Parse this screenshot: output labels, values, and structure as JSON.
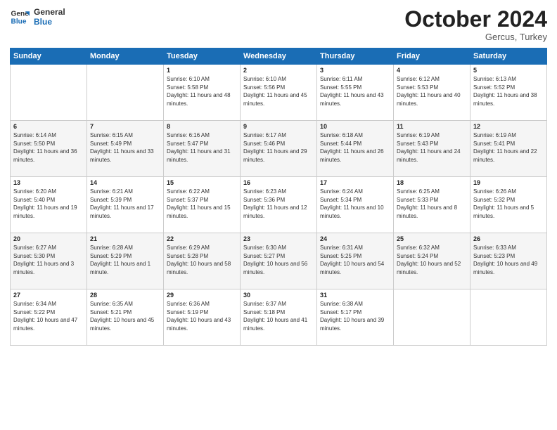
{
  "logo": {
    "line1": "General",
    "line2": "Blue"
  },
  "title": "October 2024",
  "subtitle": "Gercus, Turkey",
  "headers": [
    "Sunday",
    "Monday",
    "Tuesday",
    "Wednesday",
    "Thursday",
    "Friday",
    "Saturday"
  ],
  "weeks": [
    [
      {
        "num": "",
        "info": ""
      },
      {
        "num": "",
        "info": ""
      },
      {
        "num": "1",
        "info": "Sunrise: 6:10 AM\nSunset: 5:58 PM\nDaylight: 11 hours and 48 minutes."
      },
      {
        "num": "2",
        "info": "Sunrise: 6:10 AM\nSunset: 5:56 PM\nDaylight: 11 hours and 45 minutes."
      },
      {
        "num": "3",
        "info": "Sunrise: 6:11 AM\nSunset: 5:55 PM\nDaylight: 11 hours and 43 minutes."
      },
      {
        "num": "4",
        "info": "Sunrise: 6:12 AM\nSunset: 5:53 PM\nDaylight: 11 hours and 40 minutes."
      },
      {
        "num": "5",
        "info": "Sunrise: 6:13 AM\nSunset: 5:52 PM\nDaylight: 11 hours and 38 minutes."
      }
    ],
    [
      {
        "num": "6",
        "info": "Sunrise: 6:14 AM\nSunset: 5:50 PM\nDaylight: 11 hours and 36 minutes."
      },
      {
        "num": "7",
        "info": "Sunrise: 6:15 AM\nSunset: 5:49 PM\nDaylight: 11 hours and 33 minutes."
      },
      {
        "num": "8",
        "info": "Sunrise: 6:16 AM\nSunset: 5:47 PM\nDaylight: 11 hours and 31 minutes."
      },
      {
        "num": "9",
        "info": "Sunrise: 6:17 AM\nSunset: 5:46 PM\nDaylight: 11 hours and 29 minutes."
      },
      {
        "num": "10",
        "info": "Sunrise: 6:18 AM\nSunset: 5:44 PM\nDaylight: 11 hours and 26 minutes."
      },
      {
        "num": "11",
        "info": "Sunrise: 6:19 AM\nSunset: 5:43 PM\nDaylight: 11 hours and 24 minutes."
      },
      {
        "num": "12",
        "info": "Sunrise: 6:19 AM\nSunset: 5:41 PM\nDaylight: 11 hours and 22 minutes."
      }
    ],
    [
      {
        "num": "13",
        "info": "Sunrise: 6:20 AM\nSunset: 5:40 PM\nDaylight: 11 hours and 19 minutes."
      },
      {
        "num": "14",
        "info": "Sunrise: 6:21 AM\nSunset: 5:39 PM\nDaylight: 11 hours and 17 minutes."
      },
      {
        "num": "15",
        "info": "Sunrise: 6:22 AM\nSunset: 5:37 PM\nDaylight: 11 hours and 15 minutes."
      },
      {
        "num": "16",
        "info": "Sunrise: 6:23 AM\nSunset: 5:36 PM\nDaylight: 11 hours and 12 minutes."
      },
      {
        "num": "17",
        "info": "Sunrise: 6:24 AM\nSunset: 5:34 PM\nDaylight: 11 hours and 10 minutes."
      },
      {
        "num": "18",
        "info": "Sunrise: 6:25 AM\nSunset: 5:33 PM\nDaylight: 11 hours and 8 minutes."
      },
      {
        "num": "19",
        "info": "Sunrise: 6:26 AM\nSunset: 5:32 PM\nDaylight: 11 hours and 5 minutes."
      }
    ],
    [
      {
        "num": "20",
        "info": "Sunrise: 6:27 AM\nSunset: 5:30 PM\nDaylight: 11 hours and 3 minutes."
      },
      {
        "num": "21",
        "info": "Sunrise: 6:28 AM\nSunset: 5:29 PM\nDaylight: 11 hours and 1 minute."
      },
      {
        "num": "22",
        "info": "Sunrise: 6:29 AM\nSunset: 5:28 PM\nDaylight: 10 hours and 58 minutes."
      },
      {
        "num": "23",
        "info": "Sunrise: 6:30 AM\nSunset: 5:27 PM\nDaylight: 10 hours and 56 minutes."
      },
      {
        "num": "24",
        "info": "Sunrise: 6:31 AM\nSunset: 5:25 PM\nDaylight: 10 hours and 54 minutes."
      },
      {
        "num": "25",
        "info": "Sunrise: 6:32 AM\nSunset: 5:24 PM\nDaylight: 10 hours and 52 minutes."
      },
      {
        "num": "26",
        "info": "Sunrise: 6:33 AM\nSunset: 5:23 PM\nDaylight: 10 hours and 49 minutes."
      }
    ],
    [
      {
        "num": "27",
        "info": "Sunrise: 6:34 AM\nSunset: 5:22 PM\nDaylight: 10 hours and 47 minutes."
      },
      {
        "num": "28",
        "info": "Sunrise: 6:35 AM\nSunset: 5:21 PM\nDaylight: 10 hours and 45 minutes."
      },
      {
        "num": "29",
        "info": "Sunrise: 6:36 AM\nSunset: 5:19 PM\nDaylight: 10 hours and 43 minutes."
      },
      {
        "num": "30",
        "info": "Sunrise: 6:37 AM\nSunset: 5:18 PM\nDaylight: 10 hours and 41 minutes."
      },
      {
        "num": "31",
        "info": "Sunrise: 6:38 AM\nSunset: 5:17 PM\nDaylight: 10 hours and 39 minutes."
      },
      {
        "num": "",
        "info": ""
      },
      {
        "num": "",
        "info": ""
      }
    ]
  ]
}
